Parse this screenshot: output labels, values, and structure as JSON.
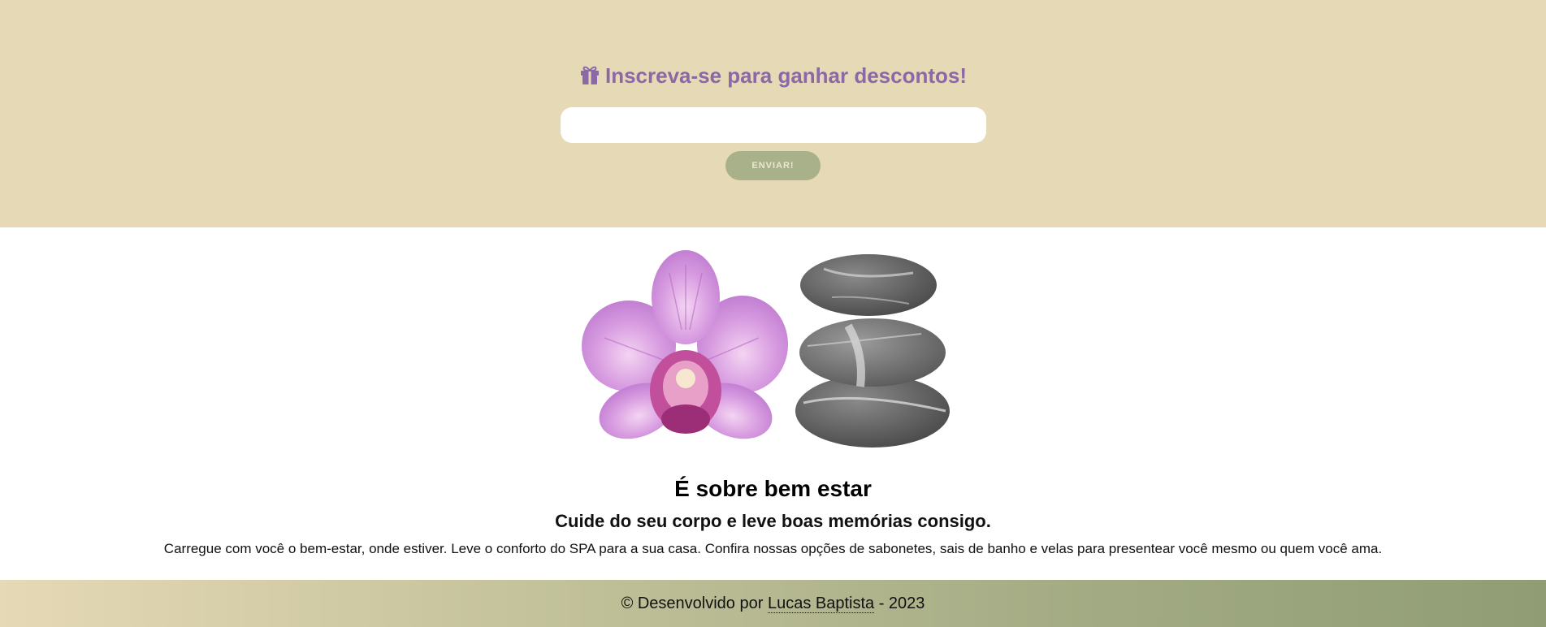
{
  "newsletter": {
    "icon": "gift-icon",
    "title": "Inscreva-se para ganhar descontos!",
    "email_value": "",
    "email_placeholder": "",
    "submit_label": "ENVIAR!"
  },
  "about": {
    "image_alt": "orchid-and-stones",
    "title": "É sobre bem estar",
    "subtitle": "Cuide do seu corpo e leve boas memórias consigo.",
    "text": "Carregue com você o bem-estar, onde estiver. Leve o conforto do SPA para a sua casa. Confira nossas opções de sabonetes, sais de banho e velas para presentear você mesmo ou quem você ama."
  },
  "footer": {
    "prefix": "© Desenvolvido por",
    "author_link": "Lucas Baptista",
    "suffix": "- 2023"
  },
  "colors": {
    "newsletter_bg": "#e6d9b6",
    "title_purple": "#8b68a6",
    "button_green": "#a9b18a",
    "footer_gradient_start": "#e6d9b6",
    "footer_gradient_end": "#909d74"
  }
}
